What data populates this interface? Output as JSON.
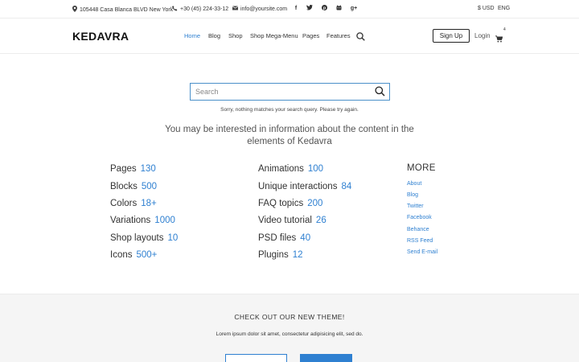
{
  "topbar": {
    "address": "105448 Casa Blanca BLVD New York",
    "phone": "+30 (45) 224-33-12",
    "email": "info@yoursite.com",
    "social": [
      "f",
      "t",
      "p",
      "g",
      "g+"
    ],
    "currency": "$ USD",
    "language": "ENG"
  },
  "header": {
    "logo": "KEDAVRA",
    "nav": [
      "Home",
      "Blog",
      "Shop",
      "Shop Mega-Menu",
      "Pages",
      "Features"
    ],
    "signup": "Sign Up",
    "login": "Login",
    "cart_count": "4"
  },
  "search": {
    "placeholder": "Search",
    "message": "Sorry, nothing matches your search query. Please try again.",
    "interest": "You may be interested in information about the content in the elements of Kedavra"
  },
  "stats_left": [
    {
      "label": "Pages",
      "value": "130"
    },
    {
      "label": "Blocks",
      "value": "500"
    },
    {
      "label": "Colors",
      "value": "18+"
    },
    {
      "label": "Variations",
      "value": "1000"
    },
    {
      "label": "Shop layouts",
      "value": "10"
    },
    {
      "label": "Icons",
      "value": "500+"
    }
  ],
  "stats_mid": [
    {
      "label": "Animations",
      "value": "100"
    },
    {
      "label": "Unique interactions",
      "value": "84"
    },
    {
      "label": "FAQ topics",
      "value": "200"
    },
    {
      "label": "Video tutorial",
      "value": "26"
    },
    {
      "label": "PSD files",
      "value": "40"
    },
    {
      "label": "Plugins",
      "value": "12"
    }
  ],
  "more": {
    "title": "MORE",
    "links": [
      "About",
      "Blog",
      "Twitter",
      "Facebook",
      "Behance",
      "RSS Feed",
      "Send E-mail"
    ]
  },
  "footer": {
    "title": "CHECK OUT OUR NEW THEME!",
    "text": "Lorem ipsum dolor sit amet, consectetur adipisicing elit, sed do."
  },
  "colors": {
    "accent": "#2f80d1",
    "footer_bg": "#f5f5f5"
  }
}
